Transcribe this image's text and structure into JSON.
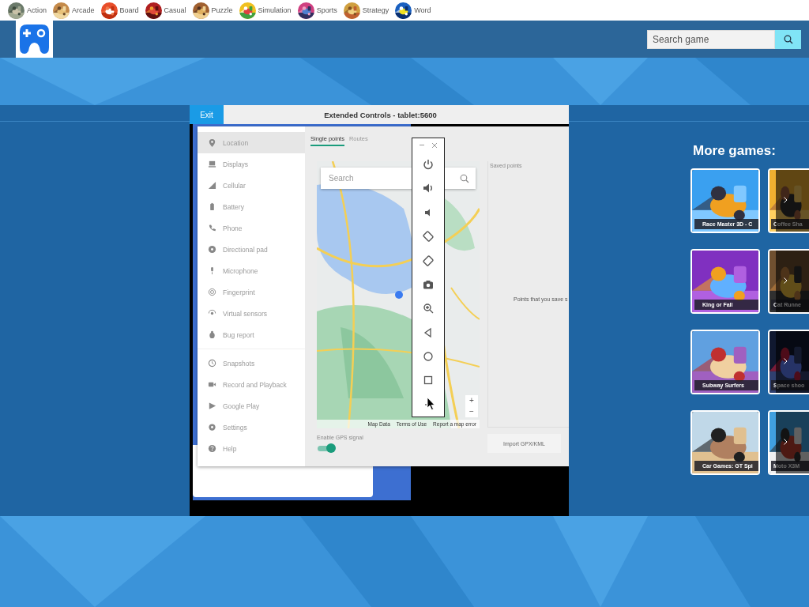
{
  "categories": [
    {
      "label": "Action"
    },
    {
      "label": "Arcade"
    },
    {
      "label": "Board"
    },
    {
      "label": "Casual"
    },
    {
      "label": "Puzzle"
    },
    {
      "label": "Simulation"
    },
    {
      "label": "Sports"
    },
    {
      "label": "Strategy"
    },
    {
      "label": "Word"
    }
  ],
  "header": {
    "search": {
      "placeholder": "Search game"
    }
  },
  "game": {
    "exit": "Exit",
    "title": "Extended Controls - tablet:5600",
    "sidebar_groups": [
      [
        {
          "label": "Location",
          "selected": true
        },
        {
          "label": "Displays",
          "selected": false
        },
        {
          "label": "Cellular",
          "selected": false
        },
        {
          "label": "Battery",
          "selected": false
        },
        {
          "label": "Phone",
          "selected": false
        },
        {
          "label": "Directional pad",
          "selected": false
        },
        {
          "label": "Microphone",
          "selected": false
        },
        {
          "label": "Fingerprint",
          "selected": false
        },
        {
          "label": "Virtual sensors",
          "selected": false
        },
        {
          "label": "Bug report",
          "selected": false
        }
      ],
      [
        {
          "label": "Snapshots",
          "selected": false
        },
        {
          "label": "Record and Playback",
          "selected": false
        },
        {
          "label": "Google Play",
          "selected": false
        },
        {
          "label": "Settings",
          "selected": false
        },
        {
          "label": "Help",
          "selected": false
        }
      ]
    ],
    "tabs": [
      {
        "label": "Single points",
        "selected": true
      },
      {
        "label": "Routes",
        "selected": false
      }
    ],
    "map": {
      "search": {
        "placeholder": "Search"
      },
      "zoom": [
        "+",
        "−"
      ],
      "attribution": [
        "Map Data",
        "Terms of Use",
        "Report a map error"
      ]
    },
    "gps": {
      "label": "Enable GPS signal",
      "on": true
    },
    "saved_points": {
      "heading": "Saved points",
      "message": "Points that you save s",
      "button": "Import GPX/KML"
    }
  },
  "more_games": {
    "title": "More games:",
    "games": [
      {
        "title": "Race Master 3D - C",
        "dimmed": false
      },
      {
        "title": "Coffee Sha",
        "dimmed": true
      },
      {
        "title": "King or Fall",
        "dimmed": false
      },
      {
        "title": "Cat Runne",
        "dimmed": true
      },
      {
        "title": "Subway Surfers",
        "dimmed": false
      },
      {
        "title": "Space shoo",
        "dimmed": true
      },
      {
        "title": "Car Games: GT Spi",
        "dimmed": false
      },
      {
        "title": "Moto X3M",
        "dimmed": true
      }
    ]
  }
}
